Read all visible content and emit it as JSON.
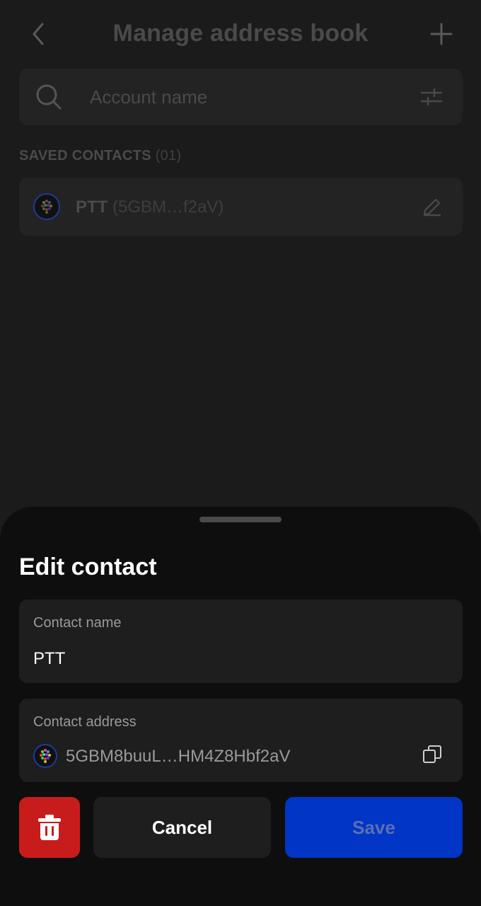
{
  "header": {
    "title": "Manage address book",
    "back_icon": "chevron-left-icon",
    "add_icon": "plus-icon"
  },
  "search": {
    "placeholder": "Account name",
    "icon": "search-icon",
    "filter_icon": "sliders-icon"
  },
  "contacts_section": {
    "label": "SAVED CONTACTS",
    "count": "(01)",
    "items": [
      {
        "name": "PTT",
        "address_short": "(5GBM…f2aV)"
      }
    ]
  },
  "sheet": {
    "title": "Edit contact",
    "name_field": {
      "label": "Contact name",
      "value": "PTT"
    },
    "address_field": {
      "label": "Contact address",
      "value": "5GBM8buuL…HM4Z8Hbf2aV"
    },
    "buttons": {
      "cancel": "Cancel",
      "save": "Save"
    }
  },
  "colors": {
    "background": "#1b1b1b",
    "sheet_bg": "#0e0e0e",
    "delete": "#c81c1c",
    "save": "#0035c6"
  }
}
